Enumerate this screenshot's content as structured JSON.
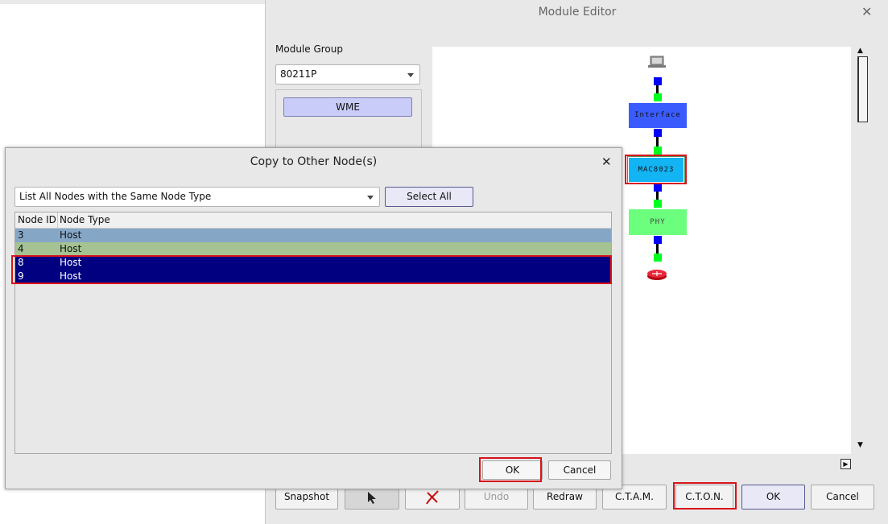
{
  "module_editor": {
    "title": "Module Editor",
    "module_group_label": "Module Group",
    "module_group_value": "80211P",
    "group_button": "WME",
    "modules": {
      "interface": "Interface",
      "mac": "MAC8023",
      "phy": "PHY"
    },
    "toolbar": {
      "snapshot": "Snapshot",
      "undo": "Undo",
      "redraw": "Redraw",
      "ctam": "C.T.A.M.",
      "cton": "C.T.O.N.",
      "ok": "OK",
      "cancel": "Cancel"
    }
  },
  "copy_dialog": {
    "title": "Copy to Other Node(s)",
    "filter_value": "List All Nodes with the Same Node Type",
    "select_all": "Select All",
    "columns": [
      "Node ID",
      "Node Type"
    ],
    "rows": [
      {
        "id": "3",
        "type": "Host"
      },
      {
        "id": "4",
        "type": "Host"
      },
      {
        "id": "8",
        "type": "Host"
      },
      {
        "id": "9",
        "type": "Host"
      }
    ],
    "ok": "OK",
    "cancel": "Cancel"
  },
  "colors": {
    "highlight": "#d8141c",
    "selection": "#000080",
    "link_blue": "#0000ff",
    "link_green": "#00ff20"
  }
}
